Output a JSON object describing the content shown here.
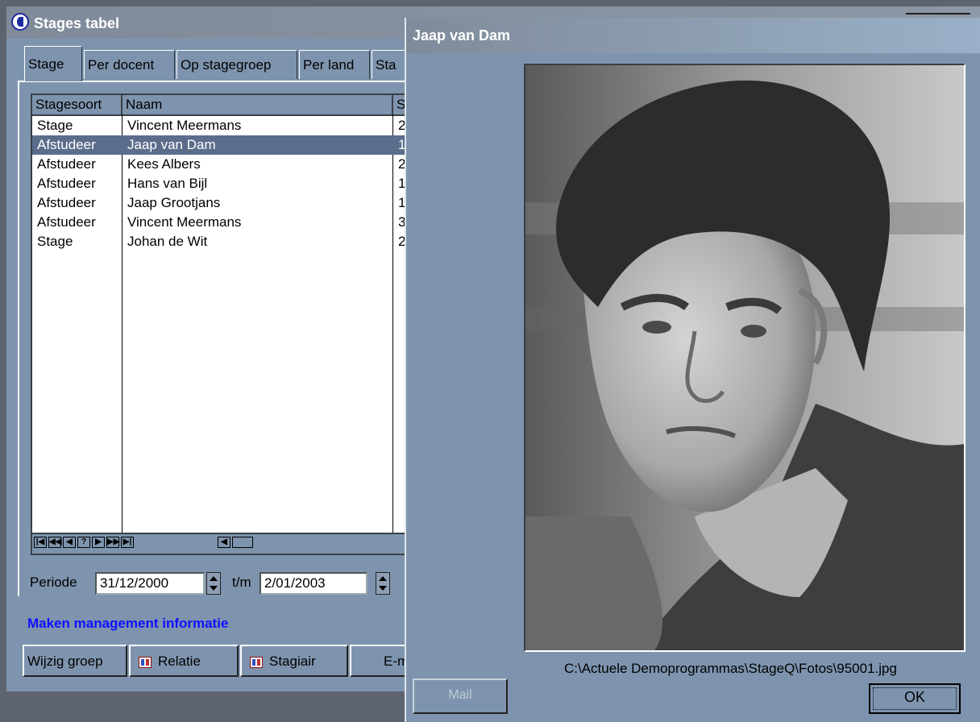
{
  "main_window": {
    "title": "Stages tabel",
    "tabs": [
      "Stage",
      "Per docent",
      "Op stagegroep",
      "Per land",
      "Sta"
    ],
    "grid": {
      "columns": [
        "Stagesoort",
        "Naam",
        "S"
      ],
      "rows": [
        {
          "soort": "Stage",
          "naam": "Vincent  Meermans",
          "s": "2"
        },
        {
          "soort": "Afstudeer",
          "naam": "Jaap van Dam",
          "s": "1"
        },
        {
          "soort": "Afstudeer",
          "naam": "Kees  Albers",
          "s": "2"
        },
        {
          "soort": "Afstudeer",
          "naam": "Hans van Bijl",
          "s": "1"
        },
        {
          "soort": "Afstudeer",
          "naam": "Jaap  Grootjans",
          "s": "1"
        },
        {
          "soort": "Afstudeer",
          "naam": "Vincent  Meermans",
          "s": "3"
        },
        {
          "soort": "Stage",
          "naam": "Johan de Wit",
          "s": "2"
        }
      ],
      "selected_row": 1
    },
    "periode": {
      "label": "Periode",
      "from": "31/12/2000",
      "to_label": "t/m",
      "to": "2/01/2003"
    },
    "management_label": "Maken management informatie",
    "buttons": {
      "wijzig_groep": "Wijzig groep",
      "relatie": "Relatie",
      "stagiair": "Stagiair",
      "email": "E-m"
    }
  },
  "dialog": {
    "title": "Jaap van Dam",
    "file_path": "C:\\Actuele Demoprogrammas\\StageQ\\Fotos\\95001.jpg",
    "mail_label": "Mail",
    "ok_label": "OK"
  },
  "colors": {
    "window_bg": "#7e94ae",
    "selection": "#5b6d8b",
    "link_blue": "#1010ff"
  }
}
